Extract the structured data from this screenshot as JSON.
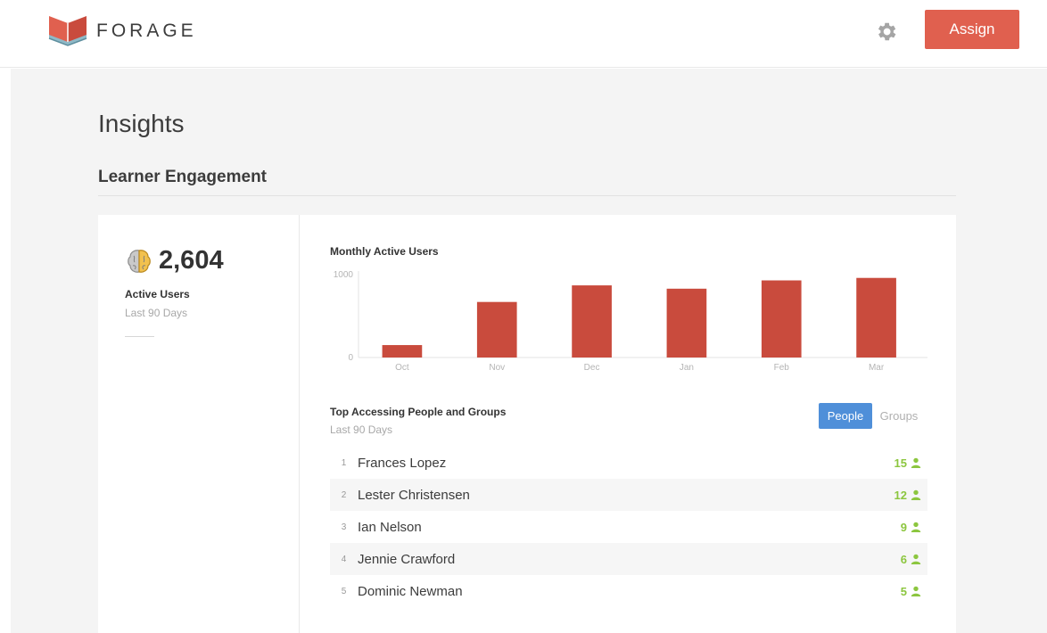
{
  "header": {
    "brand": "FORAGE",
    "assign_label": "Assign"
  },
  "page": {
    "title": "Insights",
    "section_title": "Learner Engagement"
  },
  "metric": {
    "value": "2,604",
    "label": "Active Users",
    "sublabel": "Last 90 Days"
  },
  "chart_data": {
    "type": "bar",
    "title": "Monthly Active Users",
    "categories": [
      "Oct",
      "Nov",
      "Dec",
      "Jan",
      "Feb",
      "Mar"
    ],
    "values": [
      150,
      670,
      870,
      830,
      930,
      960
    ],
    "yticks": [
      0,
      1000
    ],
    "ylim": [
      0,
      1000
    ],
    "grid": false,
    "color": "#c94b3d"
  },
  "top_list": {
    "title": "Top Accessing People and Groups",
    "sublabel": "Last 90 Days",
    "toggle_people": "People",
    "toggle_groups": "Groups",
    "rows": [
      {
        "rank": "1",
        "name": "Frances Lopez",
        "count": "15"
      },
      {
        "rank": "2",
        "name": "Lester Christensen",
        "count": "12"
      },
      {
        "rank": "3",
        "name": "Ian Nelson",
        "count": "9"
      },
      {
        "rank": "4",
        "name": "Jennie Crawford",
        "count": "6"
      },
      {
        "rank": "5",
        "name": "Dominic Newman",
        "count": "5"
      }
    ]
  },
  "icons": {
    "logo": "book-logo-icon",
    "settings": "gear-icon",
    "metric": "brain-icon",
    "count": "person-icon"
  },
  "colors": {
    "accent": "#e0604f",
    "bar": "#c94b3d",
    "selected_toggle": "#4f8fd9",
    "count": "#8cc63f"
  }
}
